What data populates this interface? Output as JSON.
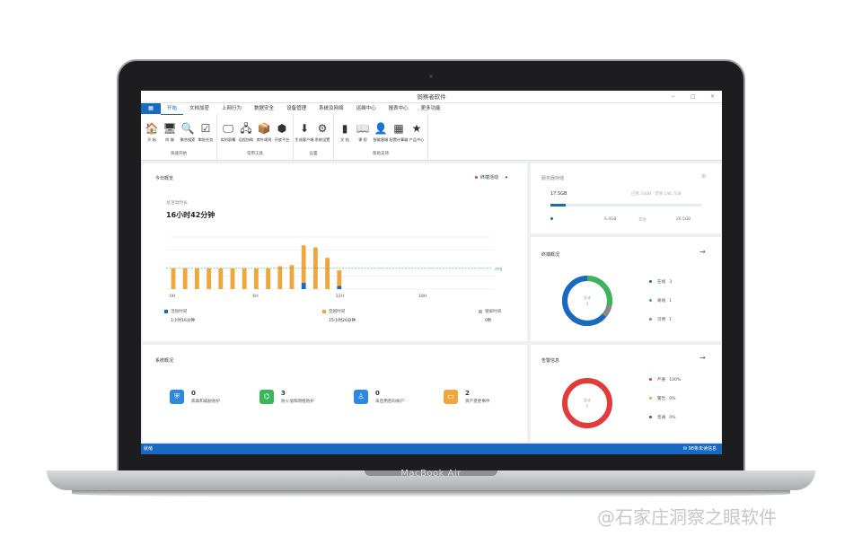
{
  "device": {
    "brand": "MacBook Air"
  },
  "watermark": "@石家庄洞察之眼软件",
  "window": {
    "title": "洞察者软件",
    "controls": [
      "−",
      "□",
      "✕"
    ]
  },
  "menu": {
    "home_icon": "grid-icon",
    "items": [
      "开始",
      "文档加密",
      "上网行为",
      "数据安全",
      "设备管理",
      "系统及网络",
      "运维中心",
      "报表中心",
      "更多功能"
    ]
  },
  "ribbon": {
    "groups": [
      {
        "label": "快速开始",
        "tools": [
          {
            "label": "开 始",
            "icon": "🏠"
          },
          {
            "label": "终 端",
            "icon": "🖥"
          },
          {
            "label": "聚合搜索",
            "icon": "🔍"
          },
          {
            "label": "审批任务",
            "icon": "☑"
          }
        ]
      },
      {
        "label": "常用工具",
        "tools": [
          {
            "label": "实时屏幕",
            "icon": "🖵"
          },
          {
            "label": "远程协助",
            "icon": "🖧"
          },
          {
            "label": "库外规则",
            "icon": "📦"
          },
          {
            "label": "开放平台",
            "icon": "⬢"
          }
        ]
      },
      {
        "label": "设置",
        "tools": [
          {
            "label": "生成客户端",
            "icon": "⬇"
          },
          {
            "label": "系统设置",
            "icon": "⚙"
          }
        ]
      },
      {
        "label": "帮助支持",
        "tools": [
          {
            "label": "文 档",
            "icon": "▮"
          },
          {
            "label": "课 程",
            "icon": "📖"
          },
          {
            "label": "智能客服",
            "icon": "👤"
          },
          {
            "label": "配置计算器",
            "icon": "▦"
          },
          {
            "label": "产品中心",
            "icon": "★"
          }
        ]
      }
    ]
  },
  "today": {
    "title": "今日概览",
    "filter": "终端活动",
    "online_label": "总活动时长",
    "online_value": "16小时42分钟",
    "avg_label": "avg",
    "legend": [
      {
        "name": "活动时间",
        "value": "1小时16分钟",
        "color": "#1769c2"
      },
      {
        "name": "空闲时间",
        "value": "15小时26分钟",
        "color": "#f0a63c"
      },
      {
        "name": "锁屏时间",
        "value": "0秒",
        "color": "#b0b4ba"
      }
    ]
  },
  "chart_data": {
    "type": "bar",
    "x_tick_labels": [
      "0H",
      "6H",
      "12H",
      "18H"
    ],
    "categories": [
      "0",
      "1",
      "2",
      "3",
      "4",
      "5",
      "6",
      "7",
      "8",
      "9",
      "10",
      "11",
      "12",
      "13",
      "14"
    ],
    "series": [
      {
        "name": "活动时间",
        "color": "#1769c2",
        "values": [
          0,
          0,
          0,
          0,
          0,
          0,
          0,
          0,
          0,
          0,
          0,
          0.3,
          0,
          0,
          0.15
        ]
      },
      {
        "name": "空闲时间",
        "color": "#f0a63c",
        "values": [
          1,
          1,
          1,
          1,
          1,
          1,
          1,
          1,
          1,
          1.1,
          1.15,
          1.8,
          2.0,
          1.5,
          0.75
        ]
      }
    ],
    "avg_line": 1,
    "ylim": [
      0,
      2.5
    ],
    "grid": true
  },
  "server": {
    "title": "服务器存储",
    "used": "17.5GB",
    "used_short": "17",
    "used_unit": "GB",
    "free_label": "已用 33GB · 可用 146.7GB",
    "used_fraction": 0.1,
    "detail_left": "6.4GB",
    "detail_label": "其他",
    "detail_right": "26.5GB"
  },
  "terminal": {
    "title": "终端概况",
    "center_label": "总计",
    "center_value": "3",
    "stats": [
      {
        "name": "在线",
        "value": "3",
        "color": "#1769c2"
      },
      {
        "name": "离线",
        "value": "1",
        "color": "#3bb55a"
      },
      {
        "name": "可用",
        "value": "1",
        "color": "#888888"
      }
    ],
    "donut": [
      0.72,
      0.18,
      0.1
    ]
  },
  "overview": {
    "title": "系统概况",
    "cards": [
      {
        "num": "0",
        "label": "病毒和威胁防护",
        "color": "#2f87e0",
        "icon": "shield-icon",
        "glyph": "⛨"
      },
      {
        "num": "3",
        "label": "防火墙和网络防护",
        "color": "#3bb55a",
        "icon": "network-icon",
        "glyph": "⌬"
      },
      {
        "num": "0",
        "label": "未启用密码帐户",
        "color": "#2f87e0",
        "icon": "user-icon",
        "glyph": "♙"
      },
      {
        "num": "2",
        "label": "资产变更事件",
        "color": "#f0a63c",
        "icon": "disk-icon",
        "glyph": "▭"
      }
    ]
  },
  "alarm": {
    "title": "告警信息",
    "center_label": "总计",
    "center_value": "1",
    "stats": [
      {
        "name": "严重",
        "value": "100%",
        "color": "#e23b3b"
      },
      {
        "name": "警告",
        "value": "0%",
        "color": "#f0a63c"
      },
      {
        "name": "普通",
        "value": "0%",
        "color": "#555555"
      }
    ]
  },
  "status": {
    "left": "就绪",
    "right": "98条未读信息"
  }
}
